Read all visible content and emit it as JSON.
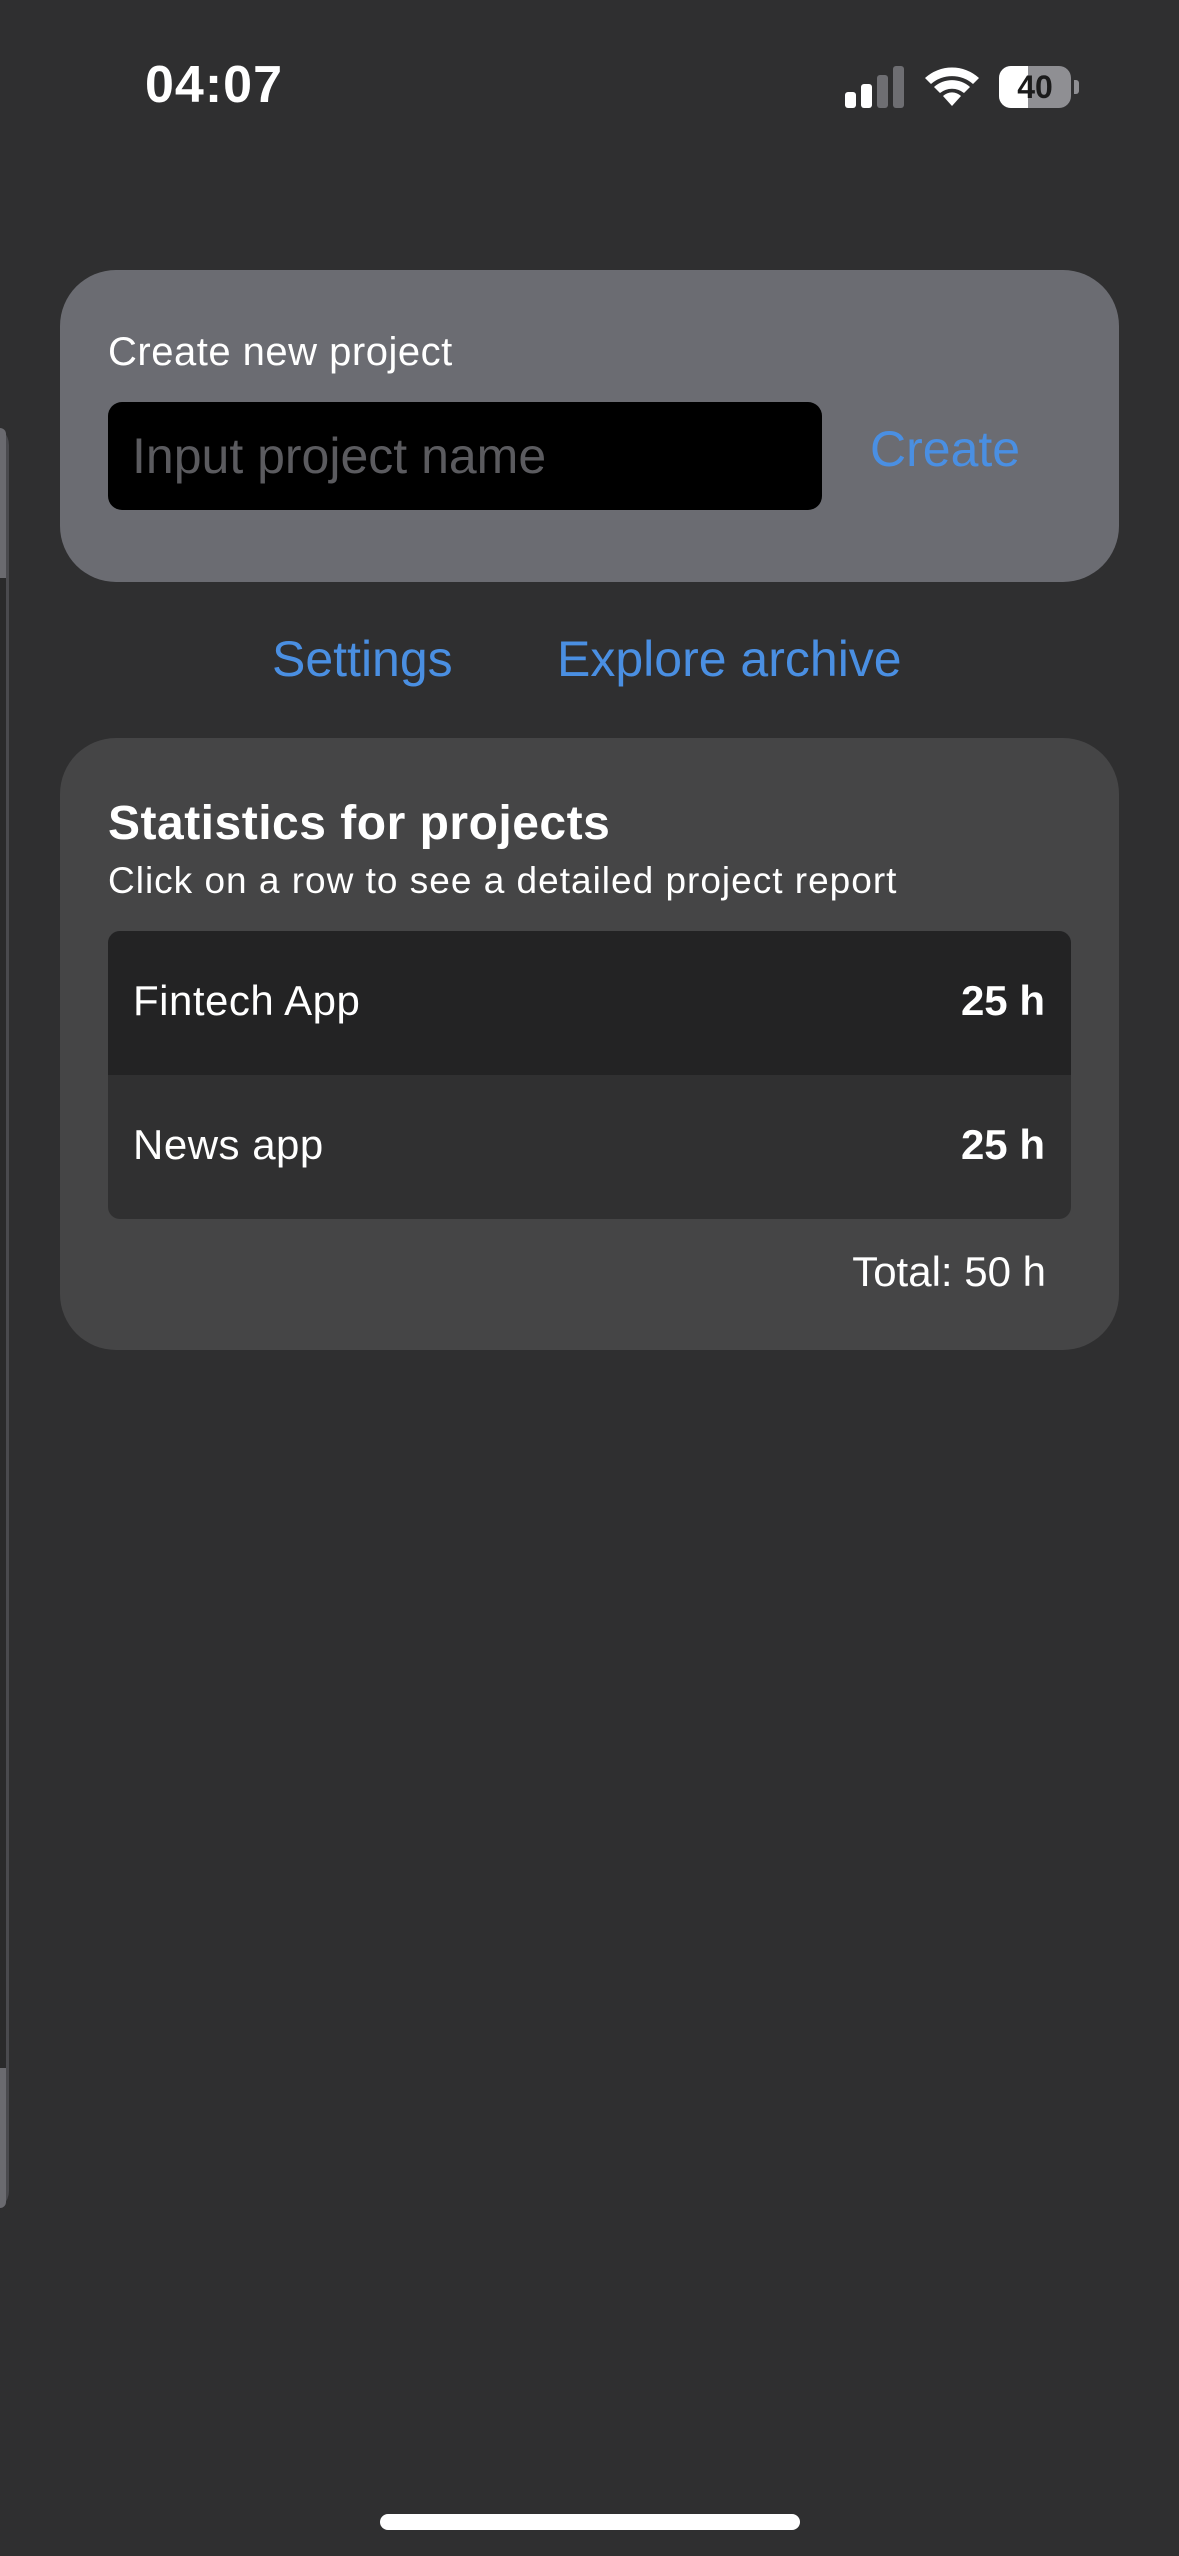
{
  "status_bar": {
    "time": "04:07",
    "battery_level": "40",
    "battery_percent": 40,
    "signal_bars_active": 2,
    "signal_icon": "cellular-signal-icon",
    "wifi_icon": "wifi-icon",
    "battery_icon": "battery-icon"
  },
  "create_project": {
    "title": "Create new project",
    "input_value": "",
    "input_placeholder": "Input project name",
    "create_label": "Create"
  },
  "links": {
    "settings_label": "Settings",
    "archive_label": "Explore archive"
  },
  "statistics": {
    "title": "Statistics for projects",
    "subtitle": "Click on a row to see a detailed project report",
    "rows": [
      {
        "name": "Fintech App",
        "hours": "25 h"
      },
      {
        "name": "News app",
        "hours": "25 h"
      }
    ],
    "total": "Total: 50 h"
  },
  "colors": {
    "background": "#2f2f30",
    "accent": "#4a8fe2",
    "create_card": "#6b6c72",
    "stats_card": "#454546"
  }
}
